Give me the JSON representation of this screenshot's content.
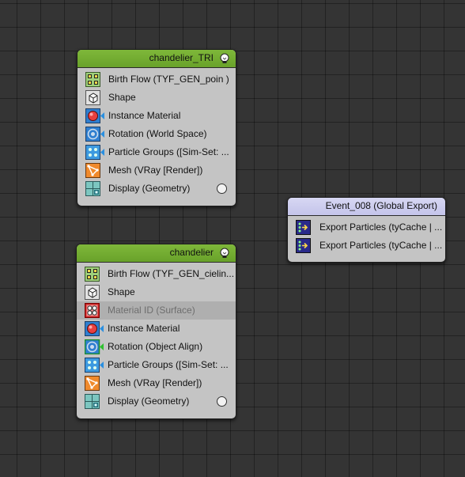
{
  "nodes": [
    {
      "title": "chandelier_TRI",
      "operators": [
        {
          "label": "Birth Flow (TYF_GEN_poin )",
          "icon": "birth-flow-icon"
        },
        {
          "label": "Shape",
          "icon": "shape-cube-icon"
        },
        {
          "label": "Instance Material",
          "icon": "instance-material-icon"
        },
        {
          "label": "Rotation (World Space)",
          "icon": "rotation-icon"
        },
        {
          "label": "Particle Groups ([Sim-Set: ...",
          "icon": "particle-groups-icon"
        },
        {
          "label": "Mesh (VRay [Render])",
          "icon": "mesh-icon"
        },
        {
          "label": "Display (Geometry)",
          "icon": "display-icon"
        }
      ]
    },
    {
      "title": "chandelier",
      "operators": [
        {
          "label": "Birth Flow (TYF_GEN_cielin...",
          "icon": "birth-flow-icon"
        },
        {
          "label": "Shape",
          "icon": "shape-cube-icon"
        },
        {
          "label": "Material ID (Surface)",
          "icon": "material-id-icon",
          "disabled": true
        },
        {
          "label": "Instance Material",
          "icon": "instance-material-icon"
        },
        {
          "label": "Rotation (Object Align)",
          "icon": "rotation-icon"
        },
        {
          "label": "Particle Groups ([Sim-Set: ...",
          "icon": "particle-groups-icon"
        },
        {
          "label": "Mesh (VRay [Render])",
          "icon": "mesh-icon"
        },
        {
          "label": "Display (Geometry)",
          "icon": "display-icon"
        }
      ]
    },
    {
      "title": "Event_008 (Global Export)",
      "operators": [
        {
          "label": "Export Particles (tyCache | ...",
          "icon": "export-particles-icon"
        },
        {
          "label": "Export Particles (tyCache | ...",
          "icon": "export-particles-icon"
        }
      ]
    }
  ],
  "colors": {
    "canvas": "#343434",
    "node_body": "#c4c4c4",
    "event_header_green": "#74ae32",
    "global_header_purple": "#cdcdee"
  }
}
